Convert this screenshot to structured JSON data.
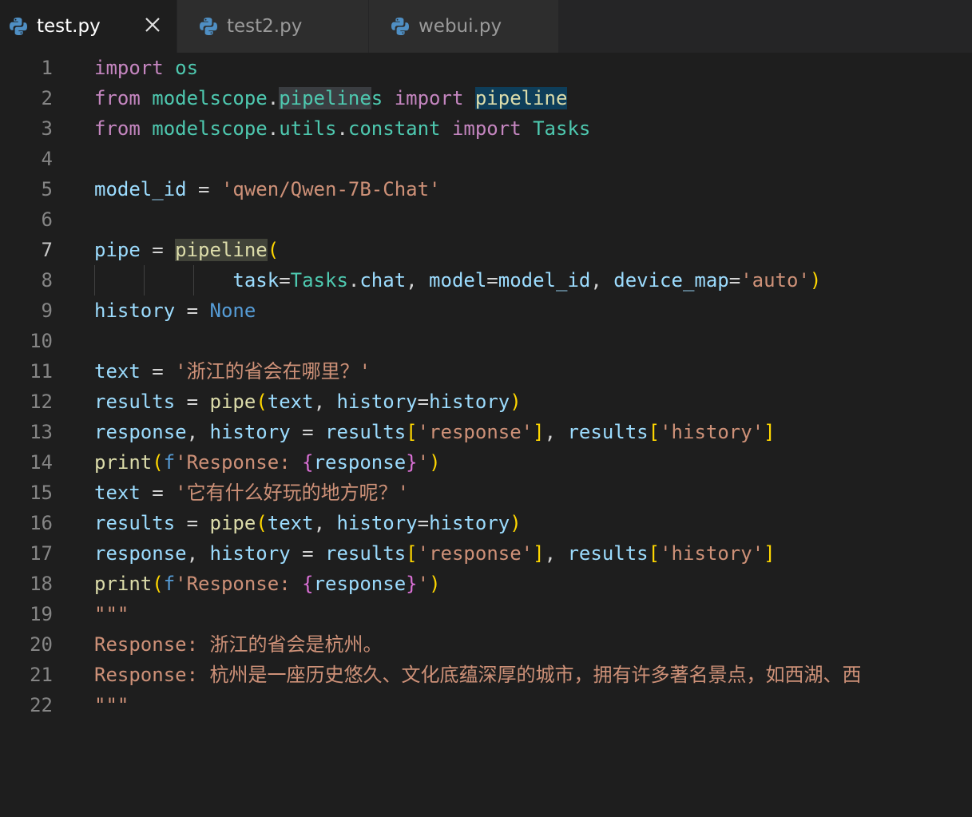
{
  "tabs": [
    {
      "label": "test.py",
      "active": true,
      "icon": "python-icon",
      "close_icon": "close-icon"
    },
    {
      "label": "test2.py",
      "active": false,
      "icon": "python-icon"
    },
    {
      "label": "webui.py",
      "active": false,
      "icon": "python-icon"
    }
  ],
  "editor": {
    "current_line": 7,
    "line_numbers": [
      "1",
      "2",
      "3",
      "4",
      "5",
      "6",
      "7",
      "8",
      "9",
      "10",
      "11",
      "12",
      "13",
      "14",
      "15",
      "16",
      "17",
      "18",
      "19",
      "20",
      "21",
      "22"
    ],
    "lines": [
      "import os",
      "from modelscope.pipelines import pipeline",
      "from modelscope.utils.constant import Tasks",
      "",
      "model_id = 'qwen/Qwen-7B-Chat'",
      "",
      "pipe = pipeline(",
      "            task=Tasks.chat, model=model_id, device_map='auto')",
      "history = None",
      "",
      "text = '浙江的省会在哪里？'",
      "results = pipe(text, history=history)",
      "response, history = results['response'], results['history']",
      "print(f'Response: {response}')",
      "text = '它有什么好玩的地方呢？'",
      "results = pipe(text, history=history)",
      "response, history = results['response'], results['history']",
      "print(f'Response: {response}')",
      "\"\"\"",
      "Response: 浙江的省会是杭州。",
      "Response: 杭州是一座历史悠久、文化底蕴深厚的城市，拥有许多著名景点，如西湖、西",
      "\"\"\""
    ]
  },
  "colors": {
    "background": "#1e1e1e",
    "tabbar": "#252526",
    "keyword": "#c586c0",
    "module": "#4ec9b0",
    "variable": "#9cdcfe",
    "function": "#dcdcaa",
    "string": "#ce9178",
    "constant": "#569cd6",
    "bracket_gold": "#ffd700",
    "bracket_purple": "#da70d6"
  }
}
